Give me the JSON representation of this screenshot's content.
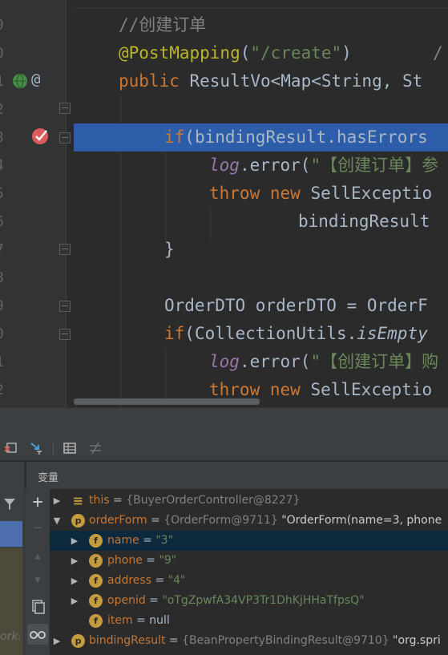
{
  "editor": {
    "gutter_numbers": [
      "9",
      "0",
      "1",
      "2",
      "3",
      "4",
      "5",
      "6",
      "7",
      "8",
      "9",
      "0",
      "1",
      "2"
    ],
    "lines": {
      "l1_comment": "//创建订单",
      "l2_ann": "@PostMapping",
      "l2_paren_open": "(",
      "l2_str": "\"/create\"",
      "l2_paren_close": ")",
      "l2_trail": "/",
      "l3_kw": "public",
      "l3_rest": " ResultVo<Map<String, St",
      "l5_kw": "if",
      "l5_rest": "(bindingResult.hasErrors",
      "l6_field": "log",
      "l6_mid": ".error(",
      "l6_str": "\"【创建订单】参",
      "l7_kw1": "throw",
      "l7_kw2": "new",
      "l7_rest": " SellExceptio",
      "l8_text": "bindingResult",
      "l9_brace": "}",
      "l11_text": "OrderDTO orderDTO = OrderF",
      "l12_kw": "if",
      "l12_a": "(CollectionUtils.",
      "l12_static": "isEmpty",
      "l13_field": "log",
      "l13_mid": ".error(",
      "l13_str": "\"【创建订单】购",
      "l14_kw1": "throw",
      "l14_kw2": "new",
      "l14_rest": " SellExceptio"
    }
  },
  "debugger": {
    "panel_title": "变量",
    "variables": [
      {
        "name": "this",
        "eq": " = ",
        "ref": "{BuyerOrderController@8227}",
        "extra": "",
        "badge": "≡"
      },
      {
        "name": "orderForm",
        "eq": " = ",
        "ref": "{OrderForm@9711}",
        "extra": " \"OrderForm(name=3, phone",
        "badge": "p"
      },
      {
        "name": "name",
        "eq": " = ",
        "ref": "",
        "extra": "\"3\"",
        "badge": "f"
      },
      {
        "name": "phone",
        "eq": " = ",
        "ref": "",
        "extra": "\"9\"",
        "badge": "f"
      },
      {
        "name": "address",
        "eq": " = ",
        "ref": "",
        "extra": "\"4\"",
        "badge": "f"
      },
      {
        "name": "openid",
        "eq": " = ",
        "ref": "",
        "extra": "\"oTgZpwfA34VP3Tr1DhKjHHaTfpsQ\"",
        "badge": "f"
      },
      {
        "name": "item",
        "eq": " = ",
        "ref": "",
        "extra": "null",
        "badge": "f"
      },
      {
        "name": "bindingResult",
        "eq": " = ",
        "ref": "{BeanPropertyBindingResult@9710}",
        "extra": " \"org.spri",
        "badge": "p"
      }
    ],
    "left_watermark": "ork."
  },
  "colors": {
    "highlight": "#2d5da8",
    "keyword": "#cc7832",
    "annotation": "#bbb529",
    "string": "#6a8759",
    "field": "#9876aa"
  }
}
